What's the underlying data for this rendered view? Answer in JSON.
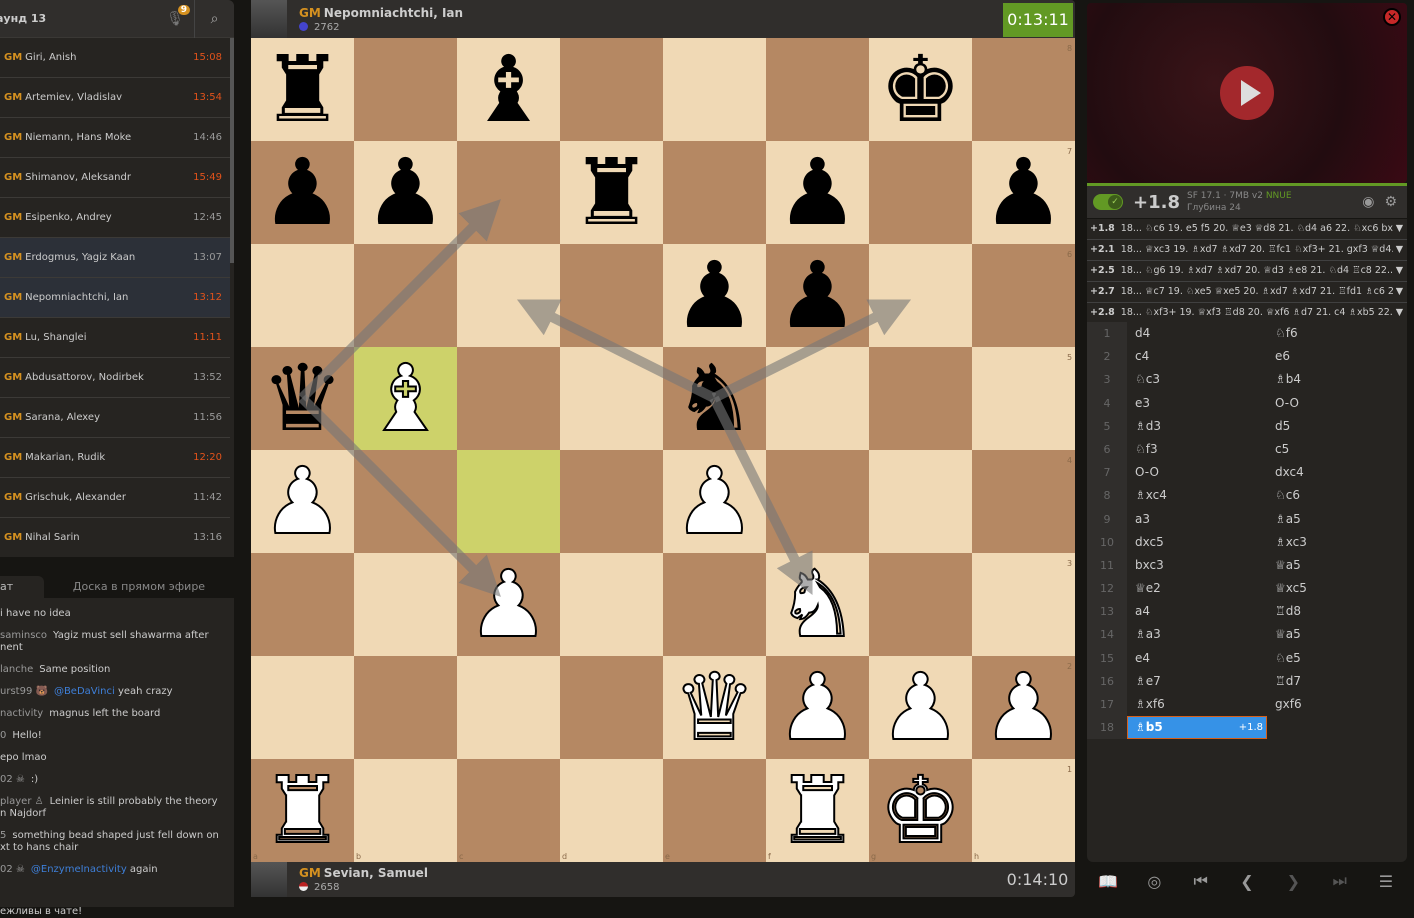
{
  "sidebar": {
    "round_title": "аунд 13",
    "mic_badge": "9",
    "games": [
      {
        "title": "GM",
        "name": "Giri, Anish",
        "time": "15:08",
        "low": true
      },
      {
        "title": "GM",
        "name": "Artemiev, Vladislav",
        "time": "13:54",
        "low": true
      },
      {
        "title": "GM",
        "name": "Niemann, Hans Moke",
        "time": "14:46",
        "low": false
      },
      {
        "title": "GM",
        "name": "Shimanov, Aleksandr",
        "time": "15:49",
        "low": true
      },
      {
        "title": "GM",
        "name": "Esipenko, Andrey",
        "time": "12:45",
        "low": false
      },
      {
        "title": "GM",
        "name": "Erdogmus, Yagiz Kaan",
        "time": "13:07",
        "low": false,
        "selected": true
      },
      {
        "title": "GM",
        "name": "Nepomniachtchi, Ian",
        "time": "13:12",
        "low": true,
        "selected": true
      },
      {
        "title": "GM",
        "name": "Lu, Shanglei",
        "time": "11:11",
        "low": true
      },
      {
        "title": "GM",
        "name": "Abdusattorov, Nodirbek",
        "time": "13:52",
        "low": false
      },
      {
        "title": "GM",
        "name": "Sarana, Alexey",
        "time": "11:56",
        "low": false
      },
      {
        "title": "GM",
        "name": "Makarian, Rudik",
        "time": "12:20",
        "low": true
      },
      {
        "title": "GM",
        "name": "Grischuk, Alexander",
        "time": "11:42",
        "low": false
      },
      {
        "title": "GM",
        "name": "Nihal Sarin",
        "time": "13:16",
        "low": false
      }
    ]
  },
  "chat": {
    "tab_chat": "ат",
    "tab_board": "Доска в прямом эфире",
    "messages": [
      {
        "user": "",
        "text": "i have no idea"
      },
      {
        "user": "saminsco",
        "text": "Yagiz must sell shawarma after\nnent"
      },
      {
        "user": "lanche",
        "text": "Same position"
      },
      {
        "user": "urst99 🐻",
        "mention": "@BeDaVinci",
        "text": " yeah crazy"
      },
      {
        "user": "nactivity",
        "text": "magnus left the board"
      },
      {
        "user": "0",
        "text": "Hello!"
      },
      {
        "user": "",
        "text": "epo lmao"
      },
      {
        "user": "02 ☠",
        "text": ":)"
      },
      {
        "user": "player ♙",
        "text": "Leinier is still probably the theory\nn Najdorf"
      },
      {
        "user": "5",
        "text": "something bead shaped just fell down on\nxt to hans chair"
      },
      {
        "user": "02 ☠",
        "mention": "@EnzymeInactivity",
        "text": " again"
      }
    ],
    "footer": "ежливы в чате!"
  },
  "top_player": {
    "title": "GM",
    "name": "Nepomniachtchi, Ian",
    "rating": "2762",
    "clock": "0:13:11"
  },
  "bottom_player": {
    "title": "GM",
    "name": "Sevian, Samuel",
    "rating": "2658",
    "clock": "0:14:10"
  },
  "board": {
    "light": "#f0d9b5",
    "dark": "#b58863",
    "highlight": [
      "b5",
      "c4"
    ],
    "pieces": [
      {
        "sq": "a8",
        "p": "r"
      },
      {
        "sq": "c8",
        "p": "b"
      },
      {
        "sq": "g8",
        "p": "k"
      },
      {
        "sq": "a7",
        "p": "p"
      },
      {
        "sq": "b7",
        "p": "p"
      },
      {
        "sq": "d7",
        "p": "r"
      },
      {
        "sq": "f7",
        "p": "p"
      },
      {
        "sq": "h7",
        "p": "p"
      },
      {
        "sq": "e6",
        "p": "p"
      },
      {
        "sq": "f6",
        "p": "p"
      },
      {
        "sq": "a5",
        "p": "q"
      },
      {
        "sq": "b5",
        "p": "B"
      },
      {
        "sq": "e5",
        "p": "n"
      },
      {
        "sq": "a4",
        "p": "P"
      },
      {
        "sq": "e4",
        "p": "P"
      },
      {
        "sq": "c3",
        "p": "P"
      },
      {
        "sq": "f3",
        "p": "N"
      },
      {
        "sq": "e2",
        "p": "Q"
      },
      {
        "sq": "f2",
        "p": "P"
      },
      {
        "sq": "g2",
        "p": "P"
      },
      {
        "sq": "h2",
        "p": "P"
      },
      {
        "sq": "a1",
        "p": "R"
      },
      {
        "sq": "f1",
        "p": "R"
      },
      {
        "sq": "g1",
        "p": "K"
      }
    ],
    "arrows": [
      [
        "e5",
        "c6"
      ],
      [
        "e5",
        "g6"
      ],
      [
        "e5",
        "f3"
      ],
      [
        "a5",
        "c7"
      ],
      [
        "a5",
        "c3"
      ]
    ],
    "files": [
      "a",
      "b",
      "c",
      "d",
      "e",
      "f",
      "g",
      "h"
    ],
    "ranks": [
      "8",
      "7",
      "6",
      "5",
      "4",
      "3",
      "2",
      "1"
    ]
  },
  "engine": {
    "eval": "+1.8",
    "name": "SF 17.1 · 7MB v2",
    "nnue": "NNUE",
    "depth": "Глубина 24",
    "lines": [
      {
        "eval": "+1.8",
        "moves": "18... ♘c6 19. e5 f5 20. ♕e3 ♕d8 21. ♘d4 a6 22. ♘xc6 bx..."
      },
      {
        "eval": "+2.1",
        "moves": "18... ♕xc3 19. ♗xd7 ♗xd7 20. ♖fc1 ♘xf3+ 21. gxf3 ♕d4..."
      },
      {
        "eval": "+2.5",
        "moves": "18... ♘g6 19. ♗xd7 ♗xd7 20. ♕d3 ♗e8 21. ♘d4 ♖c8 22...."
      },
      {
        "eval": "+2.7",
        "moves": "18... ♕c7 19. ♘xe5 ♕xe5 20. ♗xd7 ♗xd7 21. ♖fd1 ♗c6 2..."
      },
      {
        "eval": "+2.8",
        "moves": "18... ♘xf3+ 19. ♕xf3 ♖d8 20. ♕xf6 ♗d7 21. c4 ♗xb5 22...."
      }
    ]
  },
  "moves": [
    [
      "1",
      "d4",
      "♘f6"
    ],
    [
      "2",
      "c4",
      "e6"
    ],
    [
      "3",
      "♘c3",
      "♗b4"
    ],
    [
      "4",
      "e3",
      "O-O"
    ],
    [
      "5",
      "♗d3",
      "d5"
    ],
    [
      "6",
      "♘f3",
      "c5"
    ],
    [
      "7",
      "O-O",
      "dxc4"
    ],
    [
      "8",
      "♗xc4",
      "♘c6"
    ],
    [
      "9",
      "a3",
      "♗a5"
    ],
    [
      "10",
      "dxc5",
      "♗xc3"
    ],
    [
      "11",
      "bxc3",
      "♕a5"
    ],
    [
      "12",
      "♕e2",
      "♕xc5"
    ],
    [
      "13",
      "a4",
      "♖d8"
    ],
    [
      "14",
      "♗a3",
      "♕a5"
    ],
    [
      "15",
      "e4",
      "♘e5"
    ],
    [
      "16",
      "♗e7",
      "♖d7"
    ],
    [
      "17",
      "♗xf6",
      "gxf6"
    ],
    [
      "18",
      "♗b5",
      ""
    ]
  ],
  "current_move_eval": "+1.8",
  "controls": {
    "book": "📖",
    "target": "◎",
    "first": "⏮",
    "prev": "❮",
    "next": "❯",
    "last": "⏭",
    "menu": "☰"
  }
}
